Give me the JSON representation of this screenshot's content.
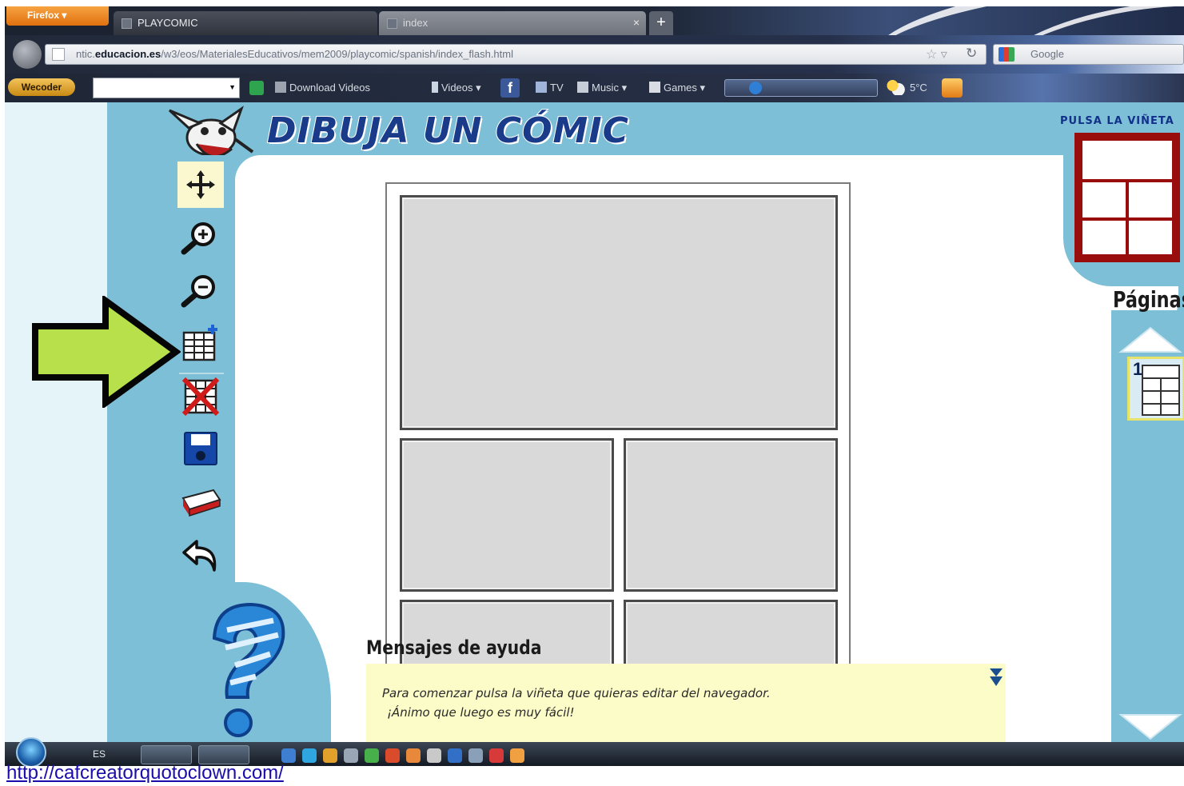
{
  "browser": {
    "firefox_menu_label": "Firefox",
    "tabs": [
      {
        "title": "PLAYCOMIC"
      },
      {
        "title": "index"
      }
    ],
    "new_tab_label": "+",
    "tab_close_glyph": "×",
    "url": {
      "prefix": "ntic.",
      "domain": "educacion.es",
      "path": "/w3/eos/MaterialesEducativos/mem2009/playcomic/spanish/index_flash.html"
    },
    "search_placeholder": "Google"
  },
  "toolbar": {
    "logo_label": "Wecoder",
    "items": {
      "download_videos": "Download Videos",
      "videos": "Videos",
      "tv": "TV",
      "music": "Music",
      "games": "Games"
    },
    "temperature": "5°C"
  },
  "app": {
    "title": "DIBUJA UN CÓMIC",
    "layout_prompt": "PULSA LA VIÑETA",
    "pages_label": "Páginas",
    "page_thumb_number": "1",
    "tools": [
      {
        "name": "move-tool",
        "icon": "move-arrows-icon"
      },
      {
        "name": "zoom-in-tool",
        "icon": "zoom-in-icon"
      },
      {
        "name": "zoom-out-tool",
        "icon": "zoom-out-icon"
      },
      {
        "name": "add-panel-tool",
        "icon": "add-grid-icon"
      },
      {
        "name": "delete-panel-tool",
        "icon": "delete-grid-icon"
      },
      {
        "name": "save-tool",
        "icon": "floppy-disk-icon"
      },
      {
        "name": "print-tool",
        "icon": "printer-icon"
      },
      {
        "name": "undo-tool",
        "icon": "undo-arrow-icon"
      }
    ],
    "help": {
      "title": "Mensajes de ayuda",
      "line_1": "Para comenzar pulsa la viñeta que quieras editar del navegador.",
      "line_2": "¡Ánimo que luego es muy fácil!"
    }
  },
  "taskbar": {
    "language": "ES"
  },
  "overlay": {
    "link_text": "http://cafcreatorquotoclown.com/"
  },
  "colors": {
    "stage_blue": "#7dbfd6",
    "title_blue": "#1a3a8a",
    "layout_red": "#9a0d0d",
    "help_yellow": "#fcfcc8",
    "arrow_green": "#b8e04a"
  }
}
